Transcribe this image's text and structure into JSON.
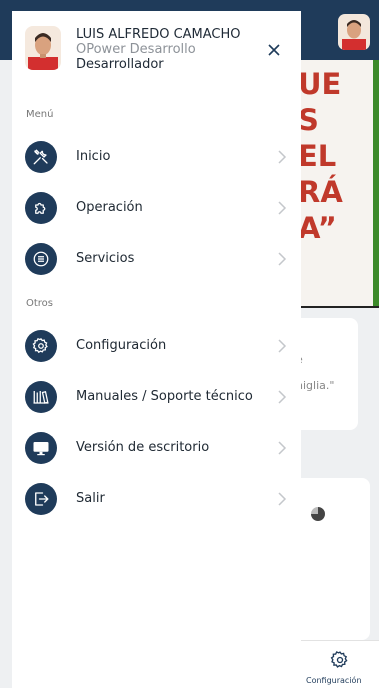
{
  "user": {
    "name": "LUIS ALFREDO CAMACHO",
    "company": "OPower Desarrollo",
    "role": "Desarrollador"
  },
  "sections": {
    "menu": "Menú",
    "otros": "Otros"
  },
  "menu_items": [
    {
      "label": "Inicio",
      "icon": "tools-icon"
    },
    {
      "label": "Operación",
      "icon": "puzzle-icon"
    },
    {
      "label": "Servicios",
      "icon": "list-icon"
    }
  ],
  "other_items": [
    {
      "label": "Configuración",
      "icon": "gear-icon"
    },
    {
      "label": "Manuales / Soporte técnico",
      "icon": "library-icon"
    },
    {
      "label": "Versión de escritorio",
      "icon": "monitor-icon"
    },
    {
      "label": "Salir",
      "icon": "logout-icon"
    }
  ],
  "background": {
    "banner_text": "UE\nS\nEL\nRÁ\nA”",
    "card_text": "e\nniglia.\"",
    "bottom_nav_label": "Configuración"
  },
  "colors": {
    "accent": "#1f3b5a",
    "banner_text": "#c0392b"
  }
}
